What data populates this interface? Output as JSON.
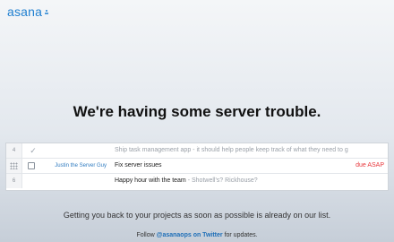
{
  "brand": {
    "logo_text": "asana",
    "color": "#1f7fd0"
  },
  "headline": "We're having some server trouble.",
  "tasks": [
    {
      "num": "4",
      "status_icon": "checkmark-icon",
      "assignee": "",
      "name": "Ship task management app",
      "description": " - it should help people keep track of what they need to g",
      "due": ""
    },
    {
      "num": "",
      "status_icon": "checkbox-icon",
      "assignee": "Justin the Server Guy",
      "name": "Fix server issues",
      "description": "",
      "due": "due ASAP"
    },
    {
      "num": "6",
      "status_icon": "",
      "assignee": "",
      "name": "Happy hour with the team",
      "description": " - Shotwell's? Rickhouse?",
      "due": ""
    }
  ],
  "message": "Getting you back to your projects as soon as possible is already on our list.",
  "footer": {
    "prefix": "Follow ",
    "link": "@asanaops on Twitter",
    "suffix": " for updates."
  },
  "colors": {
    "due": "#e8383d",
    "assignee": "#2f7bc0",
    "link": "#1f6fb8"
  }
}
